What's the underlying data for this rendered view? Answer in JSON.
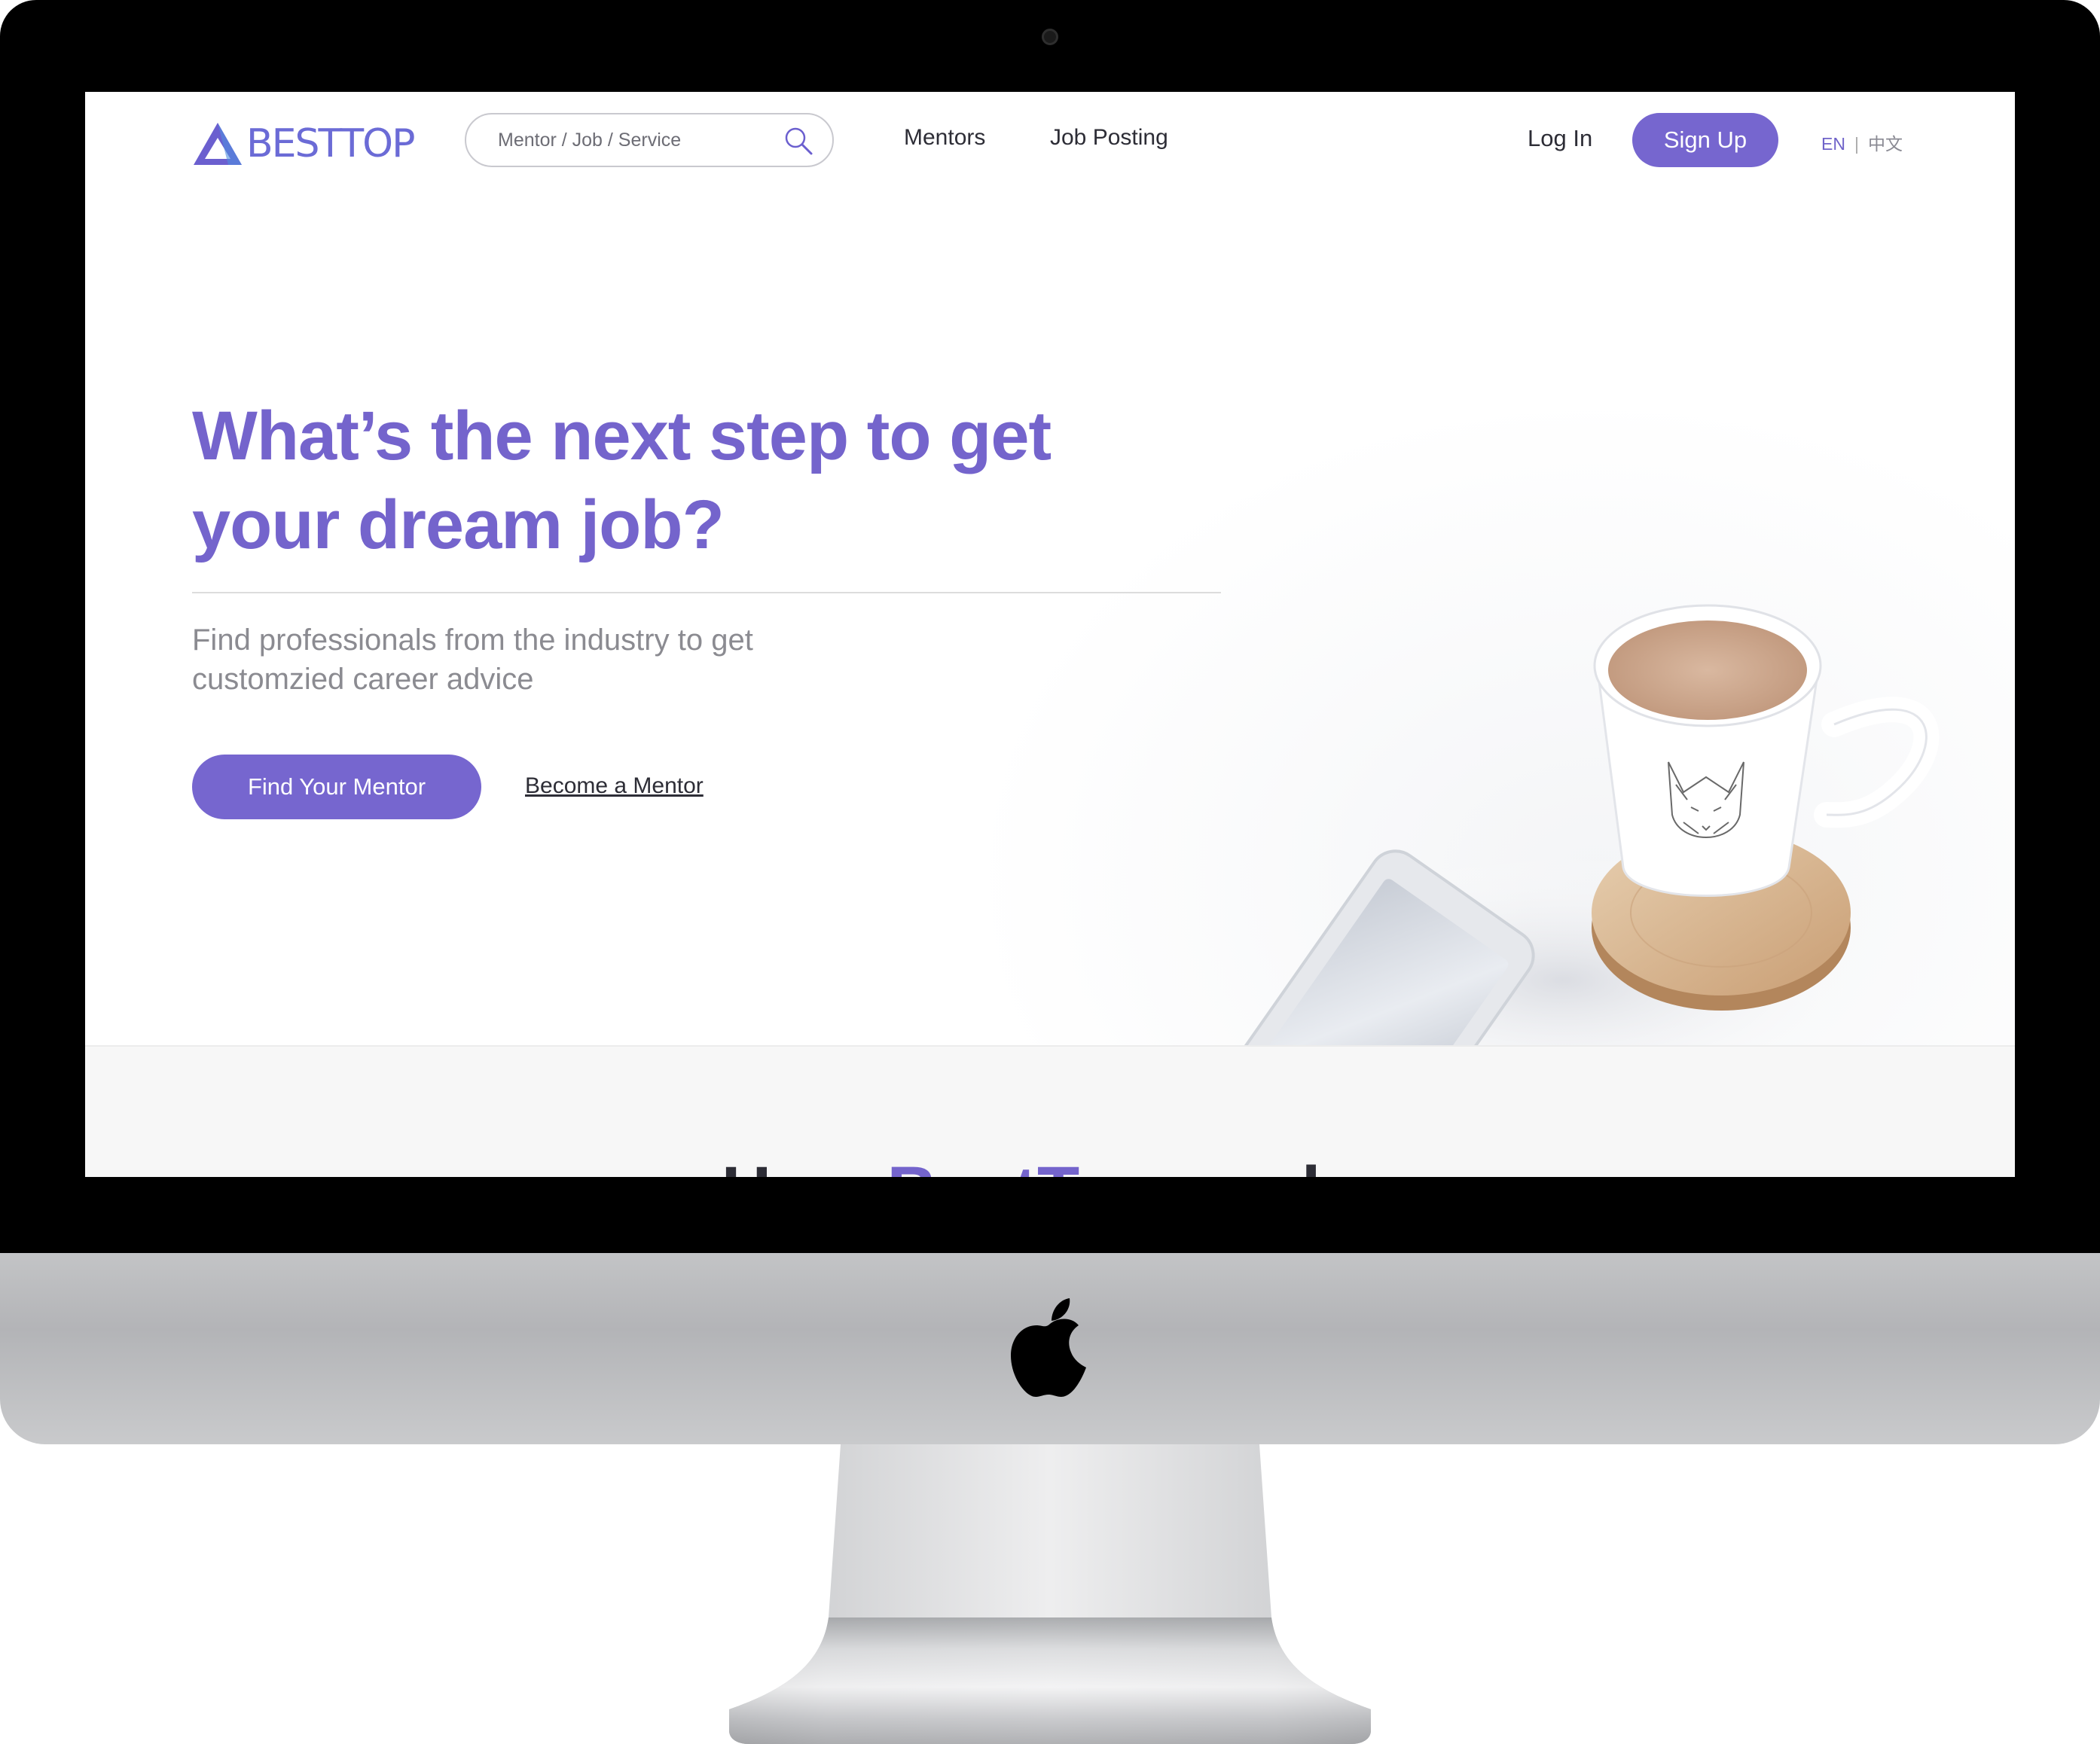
{
  "nav": {
    "logo_text": "BESTTOP",
    "search_placeholder": "Mentor / Job / Service",
    "links": [
      "Mentors",
      "Job Posting"
    ],
    "login": "Log In",
    "signup": "Sign Up",
    "lang_en": "EN",
    "lang_sep": "|",
    "lang_zh": "中文"
  },
  "hero": {
    "title": "What’s the next step to get your dream job?",
    "subtitle": "Find professionals from the industry to get customzied career advice",
    "primary_cta": "Find Your Mentor",
    "secondary_cta": "Become a Mentor"
  },
  "section": {
    "title_prefix": "How ",
    "title_brand": "BestTop",
    "title_suffix": " works"
  },
  "colors": {
    "accent": "#7666cf",
    "bezel": "#000000",
    "chin": "#c3c4c6"
  }
}
